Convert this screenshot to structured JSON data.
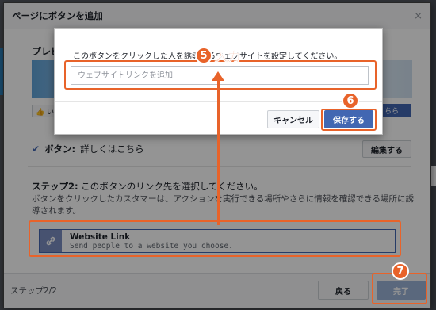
{
  "modal": {
    "title": "ページにボタンを追加",
    "close_glyph": "×",
    "preview_label": "プレビ",
    "preview_left_btn": "👍 い",
    "preview_right_btn": "ちら"
  },
  "button_row": {
    "check_glyph": "✔",
    "label": "ボタン:",
    "value": "詳しくはこちら",
    "edit_label": "編集する"
  },
  "step2": {
    "title_bold": "ステップ2:",
    "title_rest": "このボタンのリンク先を選択してください。",
    "description": "ボタンをクリックしたカスタマーは、アクションを実行できる場所やさらに情報を確認できる場所に誘導されます。"
  },
  "option": {
    "icon": "link-icon",
    "title": "Website Link",
    "subtitle": "Send people to a website you choose."
  },
  "footer": {
    "step_count": "ステップ2/2",
    "back_label": "戻る",
    "done_label": "完了"
  },
  "popup": {
    "prompt": "このボタンをクリックした人を誘導するウェブサイトを設定してください。",
    "input_placeholder": "ウェブサイトリンクを追加",
    "input_value": "",
    "cancel_label": "キャンセル",
    "save_label": "保存する"
  },
  "annotations": {
    "step5_number": "5",
    "step5_text": "入力",
    "step6_number": "6",
    "step7_number": "7",
    "color": "#e8632a"
  }
}
